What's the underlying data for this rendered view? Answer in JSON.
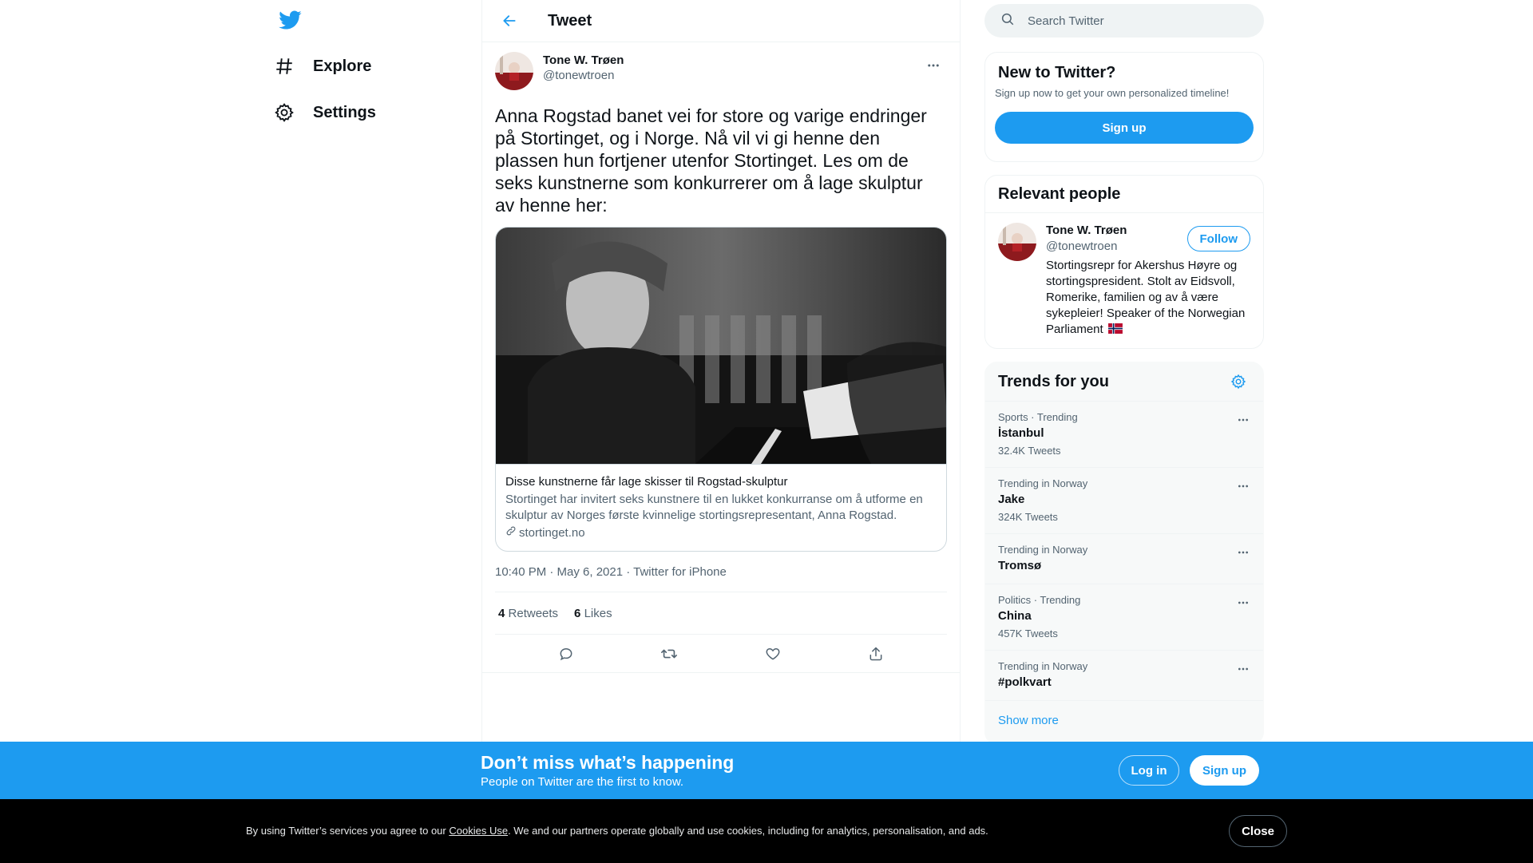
{
  "nav": {
    "logo_icon": "twitter-bird-icon",
    "items": [
      {
        "label": "Explore",
        "icon": "hashtag-icon"
      },
      {
        "label": "Settings",
        "icon": "gear-icon"
      }
    ]
  },
  "main": {
    "title": "Tweet",
    "tweet": {
      "author_name": "Tone W. Trøen",
      "author_handle": "@tonewtroen",
      "text": "Anna Rogstad banet vei for store og varige endringer på Stortinget, og i Norge. Nå vil vi gi henne den plassen hun fortjener utenfor Stortinget. Les om de seks kunstnerne som konkurrerer om å lage skulptur av henne her:",
      "card": {
        "title": "Disse kunstnerne får lage skisser til Rogstad-skulptur",
        "description": "Stortinget har invitert seks kunstnere til en lukket konkurranse om å utforme en skulptur av Norges første kvinnelige stortingsrepresentant, Anna Rogstad.",
        "domain": "stortinget.no"
      },
      "timestamp": "10:40 PM · May 6, 2021 · Twitter for iPhone",
      "retweets_count": "4",
      "retweets_label": "Retweets",
      "likes_count": "6",
      "likes_label": "Likes"
    }
  },
  "sidebar": {
    "search_placeholder": "Search Twitter",
    "new_to_twitter": {
      "title": "New to Twitter?",
      "subtitle": "Sign up now to get your own personalized timeline!",
      "signup_label": "Sign up"
    },
    "relevant_people": {
      "title": "Relevant people",
      "name": "Tone W. Trøen",
      "handle": "@tonewtroen",
      "follow_label": "Follow",
      "bio": "Stortingsrepr for Akershus Høyre og stortingspresident. Stolt av Eidsvoll, Romerike, familien og av å være sykepleier! Speaker of the Norwegian Parliament"
    },
    "trends": {
      "title": "Trends for you",
      "items": [
        {
          "meta": "Sports · Trending",
          "name": "İstanbul",
          "count": "32.4K Tweets"
        },
        {
          "meta": "Trending in Norway",
          "name": "Jake",
          "count": "324K Tweets"
        },
        {
          "meta": "Trending in Norway",
          "name": "Tromsø",
          "count": ""
        },
        {
          "meta": "Politics · Trending",
          "name": "China",
          "count": "457K Tweets"
        },
        {
          "meta": "Trending in Norway",
          "name": "#polkvart",
          "count": ""
        }
      ],
      "show_more": "Show more"
    }
  },
  "banner": {
    "title": "Don’t miss what’s happening",
    "subtitle": "People on Twitter are the first to know.",
    "login_label": "Log in",
    "signup_label": "Sign up"
  },
  "cookie": {
    "text_before": "By using Twitter’s services you agree to our ",
    "link": "Cookies Use",
    "text_after": ". We and our partners operate globally and use cookies, including for analytics, personalisation, and ads.",
    "close_label": "Close"
  },
  "colors": {
    "accent": "#1d9bf0",
    "text": "#0f1419",
    "secondary": "#536471"
  }
}
